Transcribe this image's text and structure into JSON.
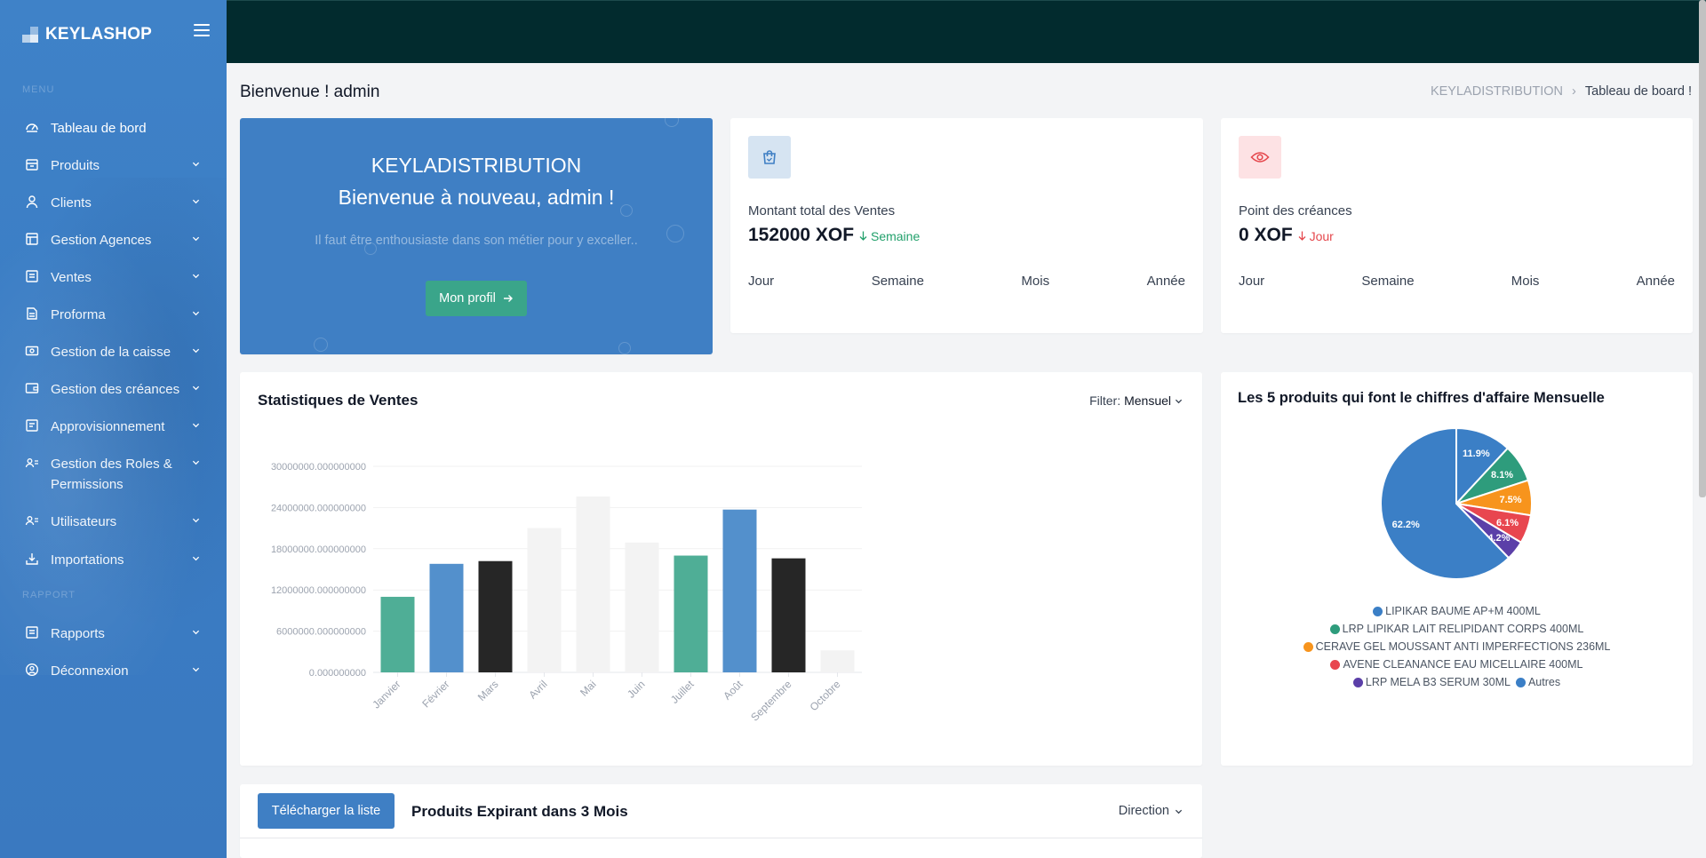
{
  "sidebar": {
    "brand": "KEYLASHOP",
    "menu_title": "MENU",
    "reports_title": "RAPPORT",
    "items": [
      {
        "label": "Tableau de bord",
        "icon": "dashboard-icon"
      },
      {
        "label": "Produits",
        "icon": "box-icon"
      },
      {
        "label": "Clients",
        "icon": "user-icon"
      },
      {
        "label": "Gestion Agences",
        "icon": "building-icon"
      },
      {
        "label": "Ventes",
        "icon": "receipt-icon"
      },
      {
        "label": "Proforma",
        "icon": "document-icon"
      },
      {
        "label": "Gestion de la caisse",
        "icon": "cash-icon"
      },
      {
        "label": "Gestion des créances",
        "icon": "wallet-icon"
      },
      {
        "label": "Approvisionnement",
        "icon": "supply-icon"
      },
      {
        "label": "Gestion des Roles & Permissions",
        "icon": "roles-icon"
      },
      {
        "label": "Utilisateurs",
        "icon": "users-icon"
      },
      {
        "label": "Importations",
        "icon": "import-icon"
      },
      {
        "label": "Rapports",
        "icon": "report-icon"
      },
      {
        "label": "Déconnexion",
        "icon": "logout-icon"
      }
    ]
  },
  "page": {
    "title": "Bienvenue ! admin",
    "breadcrumb": [
      "KEYLADISTRIBUTION",
      "Tableau de board !"
    ]
  },
  "welcome": {
    "company": "KEYLADISTRIBUTION",
    "greeting": "Bienvenue à nouveau, admin !",
    "quote": "Il faut être enthousiaste dans son métier pour y exceller..",
    "button": "Mon profil"
  },
  "stats": [
    {
      "label": "Montant total des Ventes",
      "value": "152000 XOF",
      "trend": "Semaine",
      "trend_color": "#22a06b",
      "icon": "shopping-bag-icon",
      "icon_bg": "#d6e4f2",
      "icon_color": "#3f7fc4",
      "periods": [
        "Jour",
        "Semaine",
        "Mois",
        "Année"
      ]
    },
    {
      "label": "Point des créances",
      "value": "0 XOF",
      "trend": "Jour",
      "trend_color": "#e5484d",
      "icon": "eye-icon",
      "icon_bg": "#fde2e4",
      "icon_color": "#e5484d",
      "periods": [
        "Jour",
        "Semaine",
        "Mois",
        "Année"
      ]
    }
  ],
  "sales": {
    "title": "Statistiques de Ventes",
    "filter_label": "Filter:",
    "filter_value": "Mensuel"
  },
  "pie": {
    "title": "Les 5 produits qui font le chiffres d'affaire Mensuelle"
  },
  "expiring": {
    "button": "Télécharger la liste",
    "title": "Produits Expirant dans 3 Mois",
    "direction": "Direction"
  },
  "chart_data": [
    {
      "type": "bar",
      "title": "Statistiques de Ventes",
      "categories": [
        "Janvier",
        "Février",
        "Mars",
        "Avril",
        "Mai",
        "Juin",
        "Juillet",
        "Août",
        "Septembre",
        "Octobre"
      ],
      "values": [
        11000000,
        15800000,
        16200000,
        21000000,
        25600000,
        18900000,
        17000000,
        23700000,
        16600000,
        3200000
      ],
      "colors": [
        "#4fae96",
        "#5390cc",
        "#262626",
        "#f3f3f3",
        "#f3f3f3",
        "#f3f3f3",
        "#4fae96",
        "#5390cc",
        "#262626",
        "#f3f3f3"
      ],
      "yticks": [
        "0.000000000",
        "6000000.000000000",
        "12000000.000000000",
        "18000000.000000000",
        "24000000.000000000",
        "30000000.000000000"
      ],
      "ylim": [
        0,
        30000000
      ],
      "grid": true
    },
    {
      "type": "pie",
      "title": "Les 5 produits qui font le chiffres d'affaire Mensuelle",
      "labels": [
        "LIPIKAR BAUME AP+M 400ML",
        "LRP LIPIKAR LAIT RELIPIDANT CORPS 400ML",
        "CERAVE GEL MOUSSANT ANTI IMPERFECTIONS 236ML",
        "AVENE CLEANANCE EAU MICELLAIRE 400ML",
        "LRP MELA B3 SERUM 30ML",
        "Autres"
      ],
      "values": [
        11.9,
        8.1,
        7.5,
        6.1,
        4.2,
        62.2
      ],
      "value_labels": [
        "11.9%",
        "8.1%",
        "7.5%",
        "6.1%",
        "4.2%",
        "62.2%"
      ],
      "colors": [
        "#3b7fc6",
        "#2e9c7c",
        "#f7941d",
        "#e8464f",
        "#5b3fa8",
        "#3b7fc6"
      ],
      "legend": "bottom"
    }
  ]
}
